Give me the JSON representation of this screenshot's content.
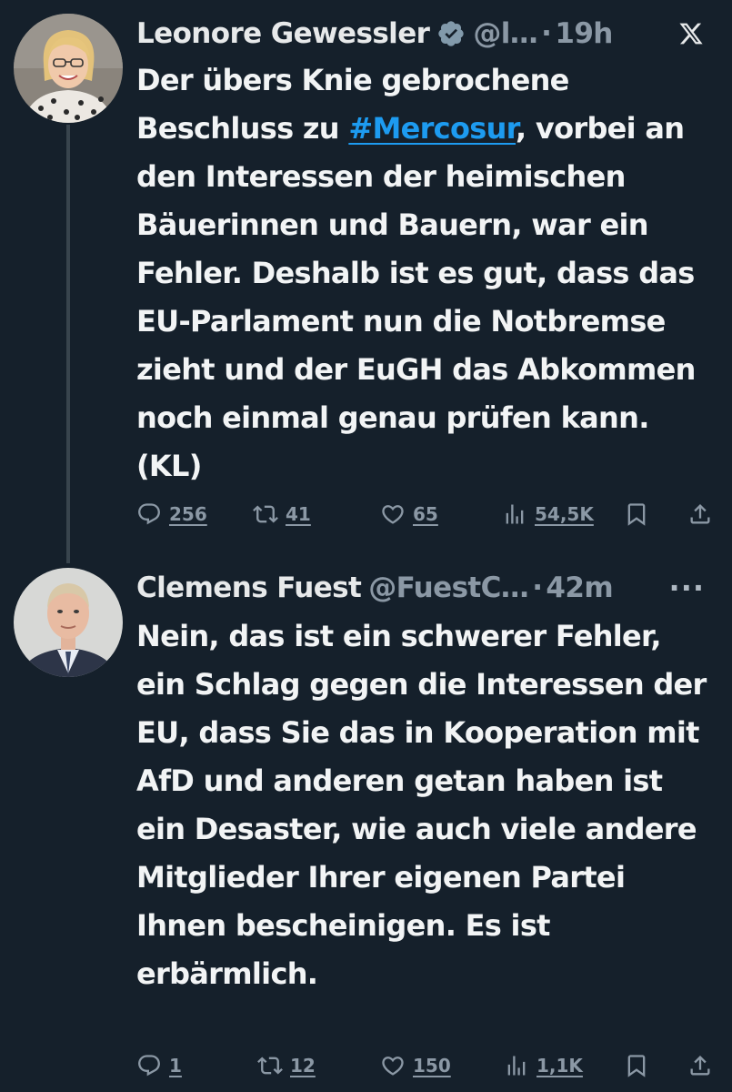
{
  "tweets": [
    {
      "author": "Leonore Gewessler",
      "handle": "@l…",
      "separator": "·",
      "time": "19h",
      "verified": true,
      "corner_icon": "x-logo-icon",
      "text_before": "Der übers Knie gebrochene Beschluss zu ",
      "hashtag": "#Mercosur",
      "text_after": ", vorbei an den Interessen der heimischen Bäuerinnen und Bauern, war ein Fehler. Deshalb ist es gut, dass das EU-Parlament nun die Notbremse zieht und der EuGH das Abkommen noch einmal genau prüfen kann. (KL)",
      "stats": {
        "replies": "256",
        "reposts": "41",
        "likes": "65",
        "views": "54,5K"
      }
    },
    {
      "author": "Clemens Fuest",
      "handle": "@FuestC…",
      "separator": "·",
      "time": "42m",
      "more": "···",
      "text": "Nein, das ist ein schwerer Fehler, ein Schlag gegen die Interessen der EU, dass Sie das in Kooperation mit AfD und anderen getan haben ist ein Desaster, wie auch viele andere Mitglieder Ihrer eigenen Partei Ihnen bescheinigen. Es ist erbärmlich.",
      "stats": {
        "replies": "1",
        "reposts": "12",
        "likes": "150",
        "views": "1,1K"
      }
    }
  ],
  "colors": {
    "background": "#15202b",
    "text": "#e7e9ea",
    "secondary": "#8b98a5",
    "link": "#1d9bf0",
    "thread_line": "#38444d"
  }
}
